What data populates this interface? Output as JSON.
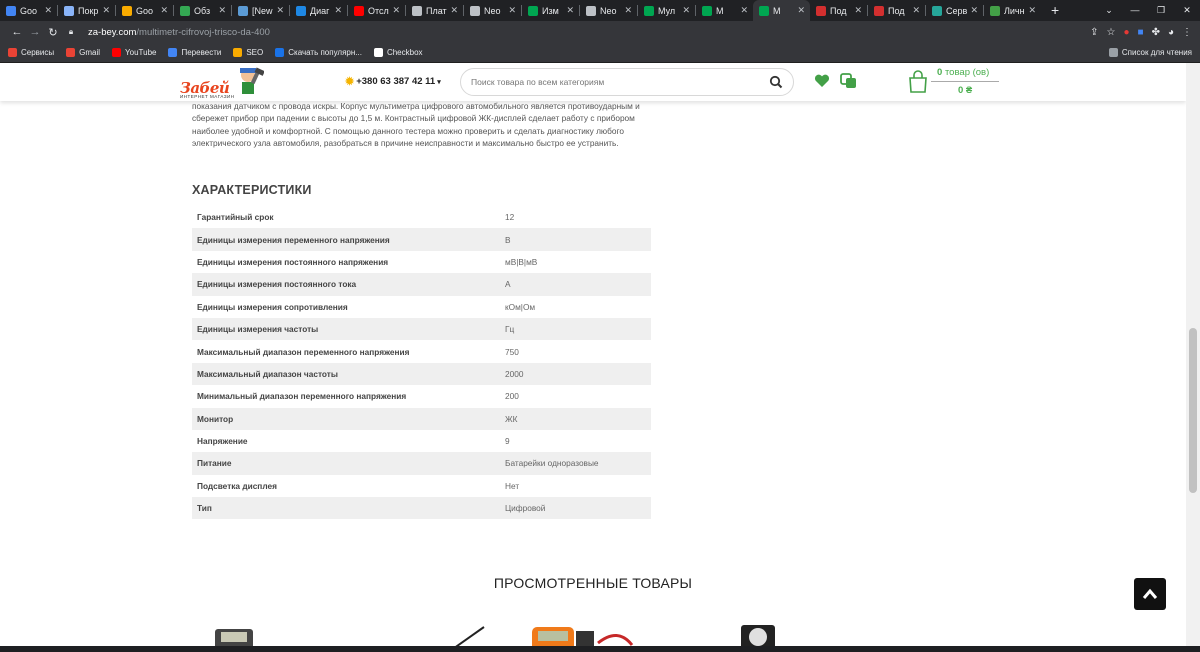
{
  "browser": {
    "tabs": [
      {
        "label": "Goo",
        "color": "#4285f4"
      },
      {
        "label": "Покр",
        "color": "#8ab4f8"
      },
      {
        "label": "Goo",
        "color": "#f9ab00"
      },
      {
        "label": "Обз",
        "color": "#34a853"
      },
      {
        "label": "[New",
        "color": "#5b9bd5"
      },
      {
        "label": "Диаг",
        "color": "#1e88e5"
      },
      {
        "label": "Отсл",
        "color": "#ff0000"
      },
      {
        "label": "Плат",
        "color": "#bdc1c6"
      },
      {
        "label": "Neo",
        "color": "#bdc1c6"
      },
      {
        "label": "Изм",
        "color": "#00a651"
      },
      {
        "label": "Neo",
        "color": "#bdc1c6"
      },
      {
        "label": "Мул",
        "color": "#00a651"
      },
      {
        "label": "M",
        "color": "#00a651"
      },
      {
        "label": "M",
        "color": "#00a651",
        "active": true
      },
      {
        "label": "Под",
        "color": "#d32f2f"
      },
      {
        "label": "Под",
        "color": "#d32f2f"
      },
      {
        "label": "Серв",
        "color": "#26a69a"
      },
      {
        "label": "Личн",
        "color": "#43a047"
      }
    ],
    "url_host": "za-bey.com",
    "url_path": "/multimetr-cifrovoj-trisco-da-400",
    "bookmarks": [
      {
        "label": "Сервисы",
        "color": "#ea4335"
      },
      {
        "label": "Gmail",
        "color": "#ea4335"
      },
      {
        "label": "YouTube",
        "color": "#ff0000"
      },
      {
        "label": "Перевести",
        "color": "#4285f4"
      },
      {
        "label": "SEO",
        "color": "#f9ab00"
      },
      {
        "label": "Скачать популярн...",
        "color": "#1a73e8"
      },
      {
        "label": "Checkbox",
        "color": "#ffffff"
      }
    ],
    "reading_list": "Список для чтения"
  },
  "header": {
    "logo_text": "Забей",
    "logo_sub": "ИНТЕРНЕТ МАГАЗИН",
    "phone": "+380 63 387 42 11",
    "search_placeholder": "Поиск товара по всем категориям",
    "cart_count": "0",
    "cart_label": "товар (ов)",
    "cart_total": "0 ₴"
  },
  "description": "показания датчиком с провода искры. Корпус мультиметра цифрового автомобильного является противоударным и сбережет прибор при падении с высоты до 1,5 м. Контрастный цифровой ЖК-дисплей сделает работу с прибором наиболее удобной и комфортной. С помощью данного тестера можно проверить и сделать диагностику любого электрического узла автомобиля, разобраться в причине неисправности и максимально быстро ее устранить.",
  "specs": {
    "title": "ХАРАКТЕРИСТИКИ",
    "rows": [
      {
        "k": "Гарантийный срок",
        "v": "12"
      },
      {
        "k": "Единицы измерения переменного напряжения",
        "v": "В"
      },
      {
        "k": "Единицы измерения постоянного напряжения",
        "v": "мВ|В|мВ"
      },
      {
        "k": "Единицы измерения постоянного тока",
        "v": "А"
      },
      {
        "k": "Единицы измерения сопротивления",
        "v": "кОм|Ом"
      },
      {
        "k": "Единицы измерения частоты",
        "v": "Гц"
      },
      {
        "k": "Максимальный диапазон переменного напряжения",
        "v": "750"
      },
      {
        "k": "Максимальный диапазон частоты",
        "v": "2000"
      },
      {
        "k": "Минимальный диапазон переменного напряжения",
        "v": "200"
      },
      {
        "k": "Монитор",
        "v": "ЖК"
      },
      {
        "k": "Напряжение",
        "v": "9"
      },
      {
        "k": "Питание",
        "v": "Батарейки одноразовые"
      },
      {
        "k": "Подсветка дисплея",
        "v": "Нет"
      },
      {
        "k": "Тип",
        "v": "Цифровой"
      }
    ]
  },
  "viewed_title": "ПРОСМОТРЕННЫЕ ТОВАРЫ"
}
